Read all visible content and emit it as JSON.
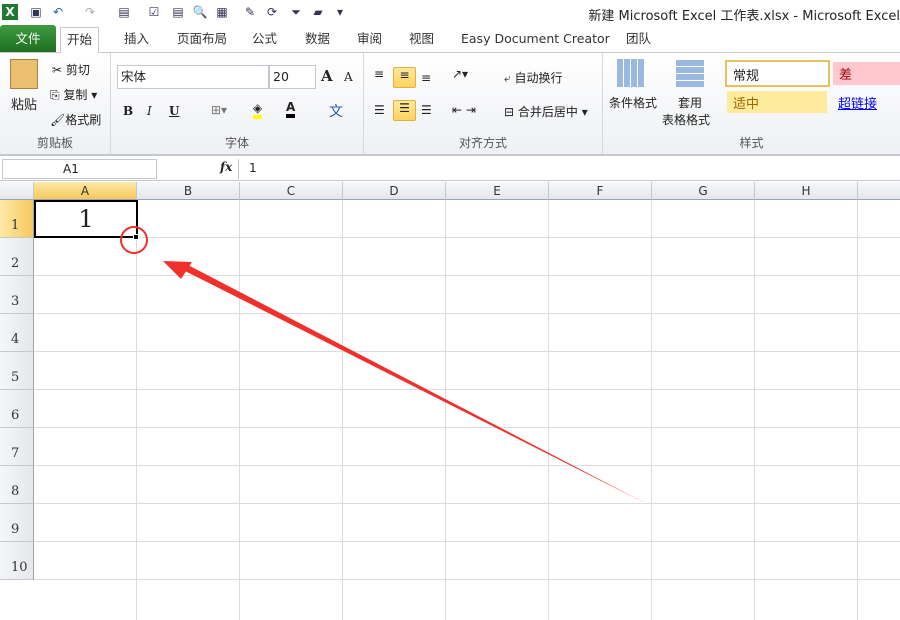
{
  "window": {
    "title": "新建 Microsoft Excel 工作表.xlsx  -  Microsoft Excel"
  },
  "tabs": [
    "文件",
    "开始",
    "插入",
    "页面布局",
    "公式",
    "数据",
    "审阅",
    "视图",
    "Easy Document Creator",
    "团队"
  ],
  "clipboard": {
    "paste": "粘贴",
    "cut": "剪切",
    "copy": "复制",
    "format_painter": "格式刷",
    "label": "剪贴板"
  },
  "font": {
    "name": "宋体",
    "size": "20",
    "bold": "B",
    "italic": "I",
    "underline": "U",
    "label": "字体",
    "grow": "A",
    "shrink": "A",
    "phonetic": "文"
  },
  "alignment": {
    "wrap": "自动换行",
    "merge": "合并后居中",
    "label": "对齐方式"
  },
  "styles": {
    "conditional": "条件格式",
    "table_line1": "套用",
    "table_line2": "表格格式",
    "normal": "常规",
    "bad": "差",
    "neutral": "适中",
    "hyperlink": "超链接",
    "label": "样式"
  },
  "formula_bar": {
    "name_box": "A1",
    "fx": "fx",
    "value": "1"
  },
  "sheet": {
    "columns": [
      "A",
      "B",
      "C",
      "D",
      "E",
      "F",
      "G",
      "H"
    ],
    "rows": [
      "1",
      "2",
      "3",
      "4",
      "5",
      "6",
      "7",
      "8",
      "9",
      "10"
    ],
    "a1": "1"
  },
  "colors": {
    "accent_green": "#2a7d2e",
    "annotation_red": "#f0302a"
  }
}
